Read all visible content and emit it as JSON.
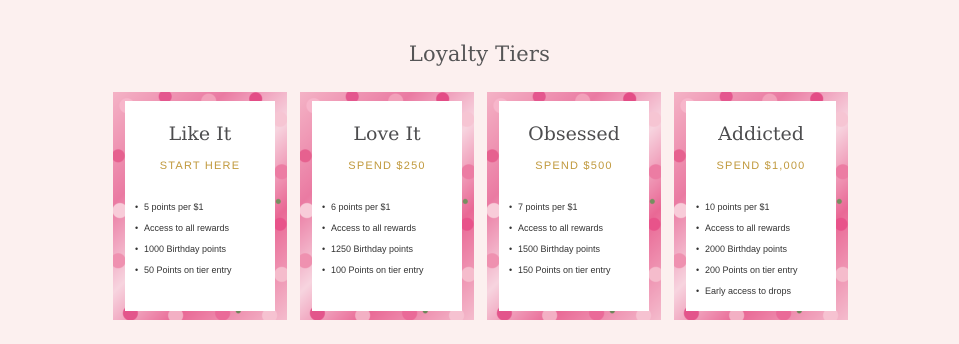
{
  "section": {
    "title": "Loyalty Tiers"
  },
  "tiers": [
    {
      "name": "Like It",
      "spend": "START HERE",
      "perks": [
        "5 points per $1",
        "Access to all rewards",
        "1000 Birthday points",
        "50 Points on tier entry"
      ]
    },
    {
      "name": "Love It",
      "spend": "SPEND $250",
      "perks": [
        "6 points per $1",
        "Access to all rewards",
        "1250 Birthday points",
        "100 Points on tier entry"
      ]
    },
    {
      "name": "Obsessed",
      "spend": "SPEND $500",
      "perks": [
        "7 points per $1",
        "Access to all rewards",
        "1500 Birthday points",
        "150 Points on tier entry"
      ]
    },
    {
      "name": "Addicted",
      "spend": "SPEND $1,000",
      "perks": [
        "10 points per $1",
        "Access to all rewards",
        "2000 Birthday points",
        "200 Points on tier entry",
        "Early access to drops"
      ]
    }
  ],
  "colors": {
    "page_background": "#fcf0ef",
    "title_text": "#555556",
    "spend_accent": "#c19a3f",
    "card_inner": "#ffffff",
    "floral_pink": "#e96895"
  }
}
